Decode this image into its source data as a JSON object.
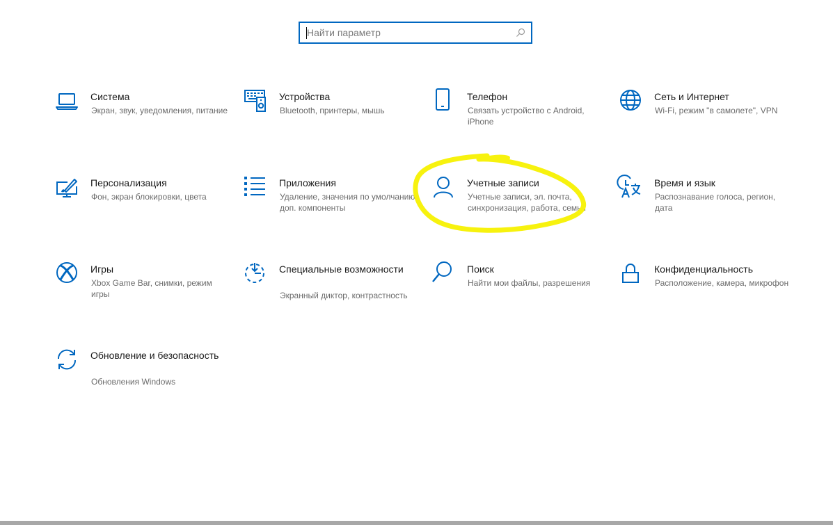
{
  "search": {
    "placeholder": "Найти параметр",
    "value": ""
  },
  "colors": {
    "accent": "#0067c0",
    "highlight": "#f7f20e",
    "title": "#1a1a1a",
    "description": "#6b6b6b"
  },
  "tiles": [
    {
      "id": "system",
      "icon": "laptop-icon",
      "title": "Система",
      "desc": "Экран, звук, уведомления, питание"
    },
    {
      "id": "devices",
      "icon": "keyboard-speaker-icon",
      "title": "Устройства",
      "desc": "Bluetooth, принтеры, мышь"
    },
    {
      "id": "phone",
      "icon": "phone-icon",
      "title": "Телефон",
      "desc": "Связать устройство с Android, iPhone"
    },
    {
      "id": "network",
      "icon": "globe-icon",
      "title": "Сеть и Интернет",
      "desc": "Wi-Fi, режим \"в самолете\", VPN"
    },
    {
      "id": "personalization",
      "icon": "paint-monitor-icon",
      "title": "Персонализация",
      "desc": "Фон, экран блокировки, цвета"
    },
    {
      "id": "apps",
      "icon": "apps-list-icon",
      "title": "Приложения",
      "desc": "Удаление, значения по умолчанию, доп. компоненты"
    },
    {
      "id": "accounts",
      "icon": "person-icon",
      "title": "Учетные записи",
      "desc": "Учетные записи, эл. почта, синхронизация, работа, семья"
    },
    {
      "id": "time-language",
      "icon": "clock-language-icon",
      "title": "Время и язык",
      "desc": "Распознавание голоса, регион, дата"
    },
    {
      "id": "gaming",
      "icon": "xbox-icon",
      "title": "Игры",
      "desc": "Xbox Game Bar, снимки, режим игры"
    },
    {
      "id": "accessibility",
      "icon": "accessibility-timer-icon",
      "title": "Специальные возможности",
      "desc": "Экранный диктор, контрастность"
    },
    {
      "id": "search",
      "icon": "magnifier-icon",
      "title": "Поиск",
      "desc": "Найти мои файлы, разрешения"
    },
    {
      "id": "privacy",
      "icon": "lock-icon",
      "title": "Конфиденциальность",
      "desc": "Расположение, камера, микрофон"
    },
    {
      "id": "update",
      "icon": "sync-arrows-icon",
      "title": "Обновление и безопасность",
      "desc": "Обновления Windows"
    }
  ]
}
